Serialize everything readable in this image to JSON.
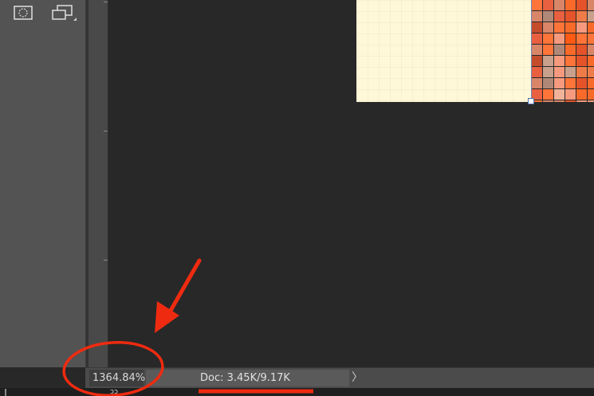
{
  "toolbar": {
    "tools": [
      {
        "icon": "quick-mask-icon"
      },
      {
        "icon": "screen-mode-icon"
      }
    ]
  },
  "status_bar": {
    "zoom": "1364.84%",
    "doc_info": "Doc: 3.45K/9.17K",
    "menu_arrow": "〉"
  },
  "bottom_strip": {
    "text": "ɔɔ"
  },
  "annotation": {
    "color": "#ee2b10"
  },
  "colors": {
    "panel": "#535353",
    "canvas": "#282828",
    "image_background": "#fff8d8"
  }
}
